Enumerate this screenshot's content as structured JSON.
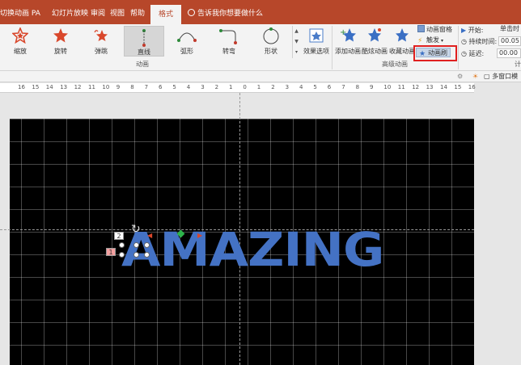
{
  "tabs": {
    "items": [
      "切换动画 PA",
      "幻灯片放映",
      "审阅",
      "视图",
      "帮助"
    ],
    "active": "格式",
    "tell_me": "告诉我你想要做什么"
  },
  "animation_gallery": {
    "items": [
      {
        "label": "缩放",
        "icon": "zoom-star-icon"
      },
      {
        "label": "旋转",
        "icon": "spin-star-icon"
      },
      {
        "label": "弹跳",
        "icon": "bounce-star-icon"
      },
      {
        "label": "直线",
        "icon": "line-path-icon",
        "selected": true
      },
      {
        "label": "弧形",
        "icon": "arc-path-icon"
      },
      {
        "label": "转弯",
        "icon": "turn-path-icon"
      },
      {
        "label": "形状",
        "icon": "shape-path-icon"
      }
    ],
    "group_label": "动画",
    "effect_options": "效果选项"
  },
  "advanced_animation": {
    "add_animation": "添加动画",
    "cool_animation": "酷炫动画",
    "collect_animation": "收藏动画",
    "animation_pane": "动画窗格",
    "trigger": "触发",
    "animation_painter": "动画刷",
    "group_label": "高级动画"
  },
  "timing": {
    "start_label": "开始:",
    "start_value": "单击时",
    "duration_label": "持续时间:",
    "duration_value": "00.05",
    "delay_label": "延迟:",
    "delay_value": "00.00",
    "group_label": "计"
  },
  "subbar": {
    "multi_window": "多窗口模"
  },
  "ruler": {
    "labels": [
      "16",
      "15",
      "14",
      "13",
      "12",
      "11",
      "10",
      "9",
      "8",
      "7",
      "6",
      "5",
      "4",
      "3",
      "2",
      "1",
      "0",
      "1",
      "2",
      "3",
      "4",
      "5",
      "6",
      "7",
      "8",
      "9",
      "10",
      "11",
      "12",
      "13",
      "14",
      "15",
      "16"
    ]
  },
  "slide": {
    "text": "AMAZING",
    "text_color": "#4472c4",
    "background": "#000000",
    "animation_tag_1": "2",
    "animation_tag_2": "1"
  },
  "colors": {
    "tab_bar": "#b7472a",
    "ribbon": "#f3f3f3",
    "highlight": "#e02020"
  }
}
